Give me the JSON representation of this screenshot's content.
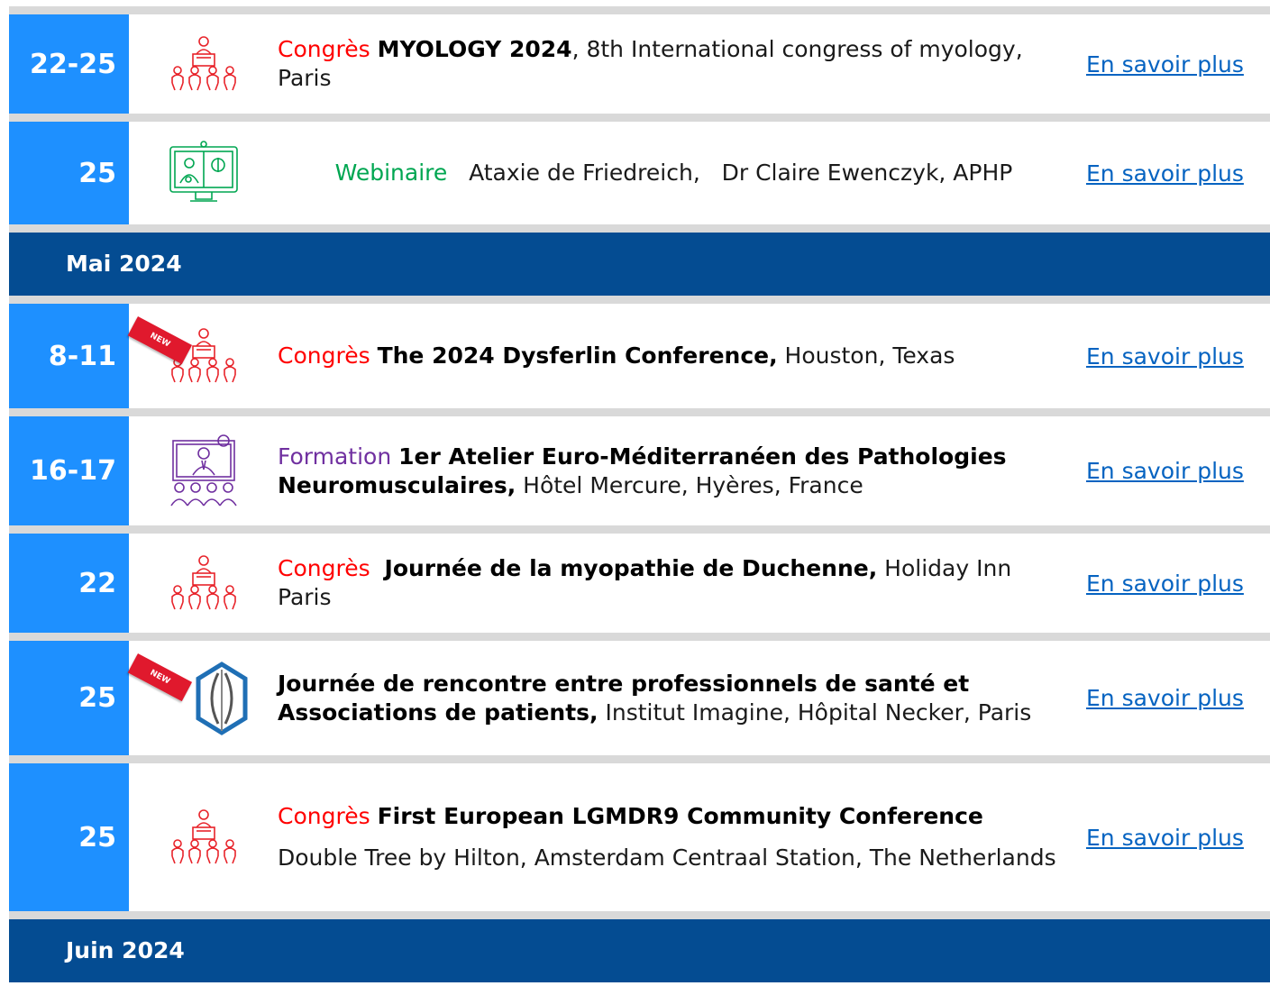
{
  "link_label": "En savoir plus",
  "colors": {
    "month_bar": "#044c92",
    "date_cell": "#1e90ff",
    "congres": "#ff0000",
    "webinaire": "#00a651",
    "formation": "#7030a0",
    "link": "#0563c1"
  },
  "months": {
    "may": "Mai 2024",
    "june": "Juin 2024"
  },
  "events": [
    {
      "date": "22-25",
      "icon": "congress-icon",
      "category": "Congrès",
      "title": "MYOLOGY 2024",
      "detail": ", 8th International congress of myology, Paris"
    },
    {
      "date": "25",
      "icon": "webinar-icon",
      "category": "Webinaire",
      "detail": "   Ataxie de Friedreich,   Dr Claire Ewenczyk, APHP"
    },
    {
      "date": "8-11",
      "icon": "congress-icon",
      "badge": "NEW",
      "category": "Congrès",
      "title": "The 2024 Dysferlin Conference,",
      "detail": " Houston, Texas"
    },
    {
      "date": "16-17",
      "icon": "training-icon",
      "category": "Formation",
      "title": "1er Atelier Euro-Méditerranéen des Pathologies Neuromusculaires,",
      "detail": " Hôtel Mercure, Hyères, France"
    },
    {
      "date": "22",
      "icon": "congress-icon",
      "category": "Congrès",
      "title": "Journée de la myopathie de Duchenne,",
      "detail": " Holiday Inn Paris"
    },
    {
      "date": "25",
      "icon": "network-logo-icon",
      "badge": "NEW",
      "title": "Journée de rencontre entre professionnels de santé et Associations de patients,",
      "detail": " Institut Imagine, Hôpital Necker, Paris"
    },
    {
      "date": "25",
      "icon": "congress-icon",
      "category": "Congrès",
      "title": "First European LGMDR9 Community Conference",
      "detail": "Double Tree by Hilton, Amsterdam Centraal Station, The Netherlands"
    }
  ]
}
